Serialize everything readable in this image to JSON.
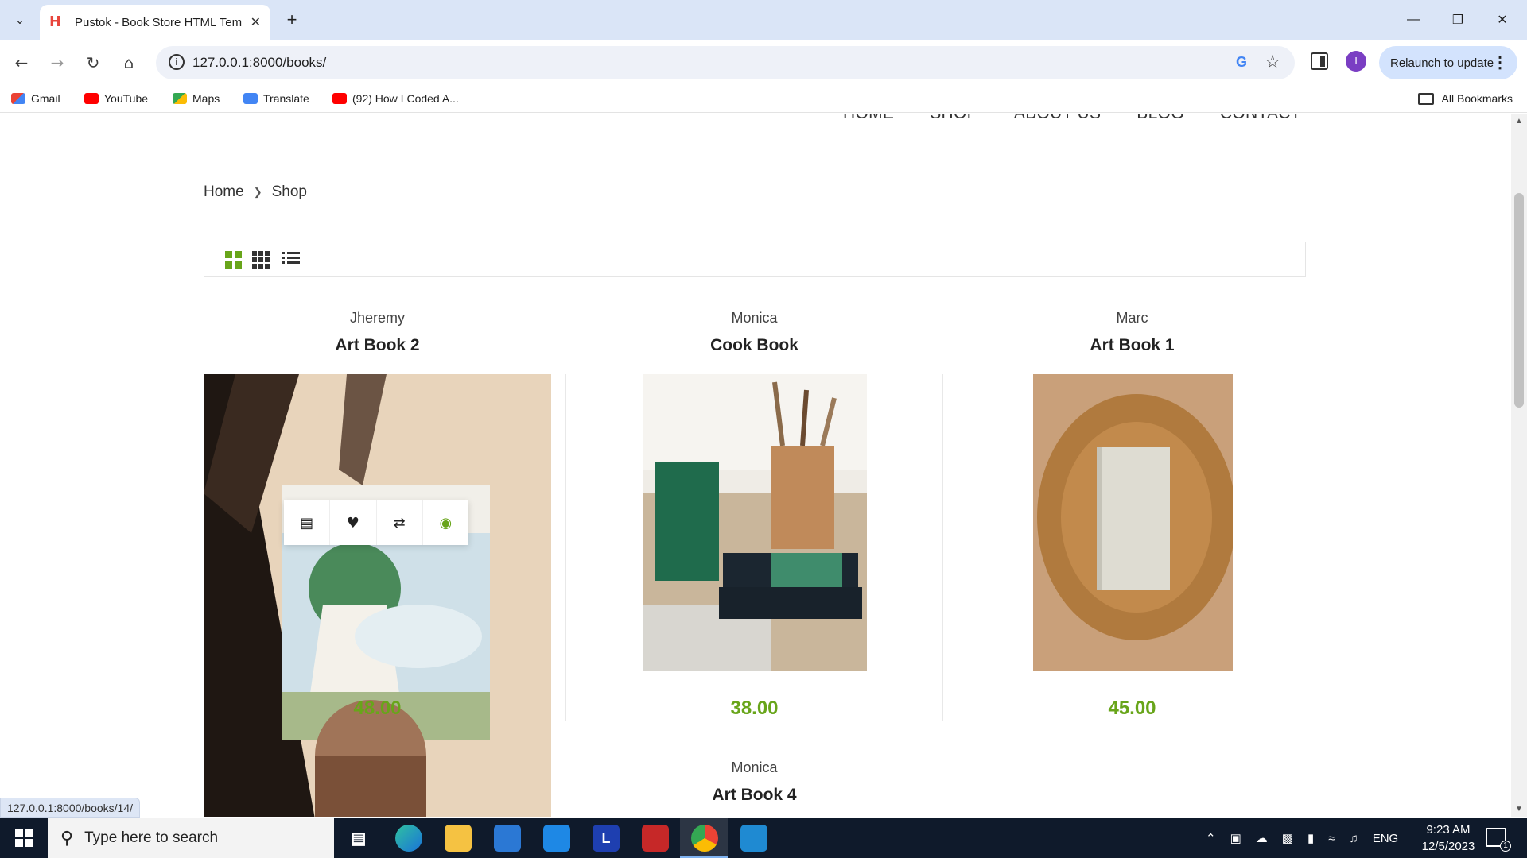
{
  "browser": {
    "tab_title": "Pustok - Book Store HTML Tem",
    "tab_favicon": "H",
    "url": "127.0.0.1:8000/books/",
    "relaunch_label": "Relaunch to update",
    "profile_initial": "I",
    "status_url": "127.0.0.1:8000/books/14/"
  },
  "bookmarks": {
    "items": [
      {
        "label": "Gmail",
        "icon": "gmail-icon"
      },
      {
        "label": "YouTube",
        "icon": "youtube-icon"
      },
      {
        "label": "Maps",
        "icon": "maps-icon"
      },
      {
        "label": "Translate",
        "icon": "translate-icon"
      },
      {
        "label": "(92) How I Coded A...",
        "icon": "youtube-icon"
      }
    ],
    "all_label": "All Bookmarks"
  },
  "nav": {
    "items": [
      "HOME",
      "SHOP",
      "ABOUT US",
      "BLOG",
      "CONTACT"
    ]
  },
  "breadcrumb": {
    "home": "Home",
    "current": "Shop"
  },
  "products": [
    {
      "author": "Jheremy",
      "title": "Art Book 2",
      "price": "48.00"
    },
    {
      "author": "Monica",
      "title": "Cook Book",
      "price": "38.00"
    },
    {
      "author": "Marc",
      "title": "Art Book 1",
      "price": "45.00"
    },
    {
      "author": "Monica",
      "title": "Art Book 4",
      "price": ""
    }
  ],
  "product_actions": [
    "cart-icon",
    "heart-icon",
    "shuffle-icon",
    "eye-icon"
  ],
  "colors": {
    "accent": "#68a51a",
    "taskbar": "#0f1a2b"
  },
  "taskbar": {
    "search_placeholder": "Type here to search",
    "time": "9:23 AM",
    "date": "12/5/2023",
    "language": "ENG",
    "notification_count": "1"
  }
}
